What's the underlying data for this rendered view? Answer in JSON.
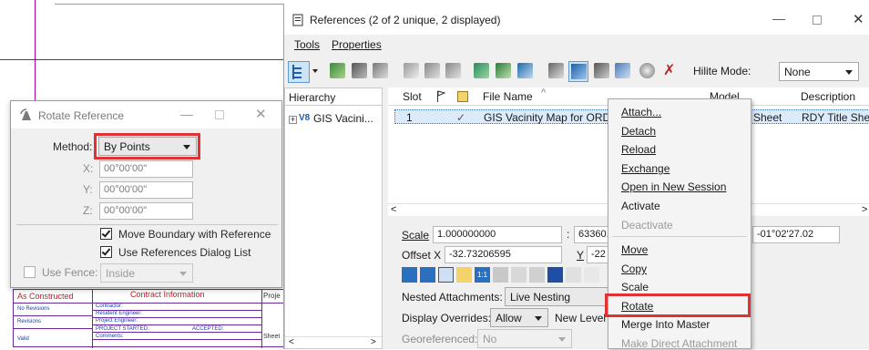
{
  "rotate_dialog": {
    "title": "Rotate Reference",
    "method_label": "Method:",
    "method_value": "By Points",
    "x_label": "X:",
    "x_value": "00°00'00\"",
    "y_label": "Y:",
    "y_value": "00°00'00\"",
    "z_label": "Z:",
    "z_value": "00°00'00\"",
    "move_boundary_label": "Move Boundary with Reference",
    "use_dialog_label": "Use References Dialog List",
    "use_fence_label": "Use Fence:",
    "fence_value": "Inside"
  },
  "references_window": {
    "title": "References (2 of 2 unique, 2 displayed)",
    "menu": [
      "Tools",
      "Properties"
    ],
    "hilite_label": "Hilite Mode:",
    "hilite_value": "None",
    "hierarchy_header": "Hierarchy",
    "hierarchy_item": "GIS Vacini...",
    "columns": {
      "slot": "Slot",
      "file_name": "File Name",
      "model": "Model",
      "description": "Description"
    },
    "row": {
      "slot": "1",
      "check": "✓",
      "file_name": "GIS Vacinity Map for ORD",
      "model": "Sheet",
      "description": "RDY Title Shee"
    },
    "scale_label": "Scale",
    "scale_value": "1.000000000",
    "scale_value2": "63360.0",
    "rotation_value": "-01°02'27.02",
    "offset_label": "Offset X",
    "offset_x_value": "-32.73206595",
    "offset_y_label": "Y",
    "offset_y_value": "-22",
    "nested_label": "Nested Attachments:",
    "nested_value": "Live Nesting",
    "display_overrides_label": "Display Overrides:",
    "display_overrides_value": "Allow",
    "new_level_label": "New Level",
    "georeferenced_label": "Georeferenced:",
    "georeferenced_value": "No"
  },
  "context_menu": {
    "items": [
      "Attach...",
      "Detach",
      "Reload",
      "Exchange",
      "Open in New Session",
      "Activate",
      "Deactivate",
      "Move",
      "Copy",
      "Scale",
      "Rotate",
      "Merge Into Master",
      "Make Direct Attachment"
    ]
  },
  "title_block": {
    "as_constructed": "As Constructed",
    "contract_info": "Contract Information",
    "proj": "Proje",
    "no_revisions": "No Revisions",
    "revisions": "Revisions",
    "valid": "Valid",
    "contractor": "Contractor:",
    "resident_engineer": "Resident Engineer:",
    "project_engineer": "Project Engineer:",
    "project_started": "PROJECT STARTED:",
    "accepted": "ACCEPTED:",
    "comments": "Comments:",
    "sheet": "Sheet"
  },
  "colors": {
    "highlight": "#e03232",
    "selection": "#dcebfb",
    "cad_line": "#b000b0"
  }
}
